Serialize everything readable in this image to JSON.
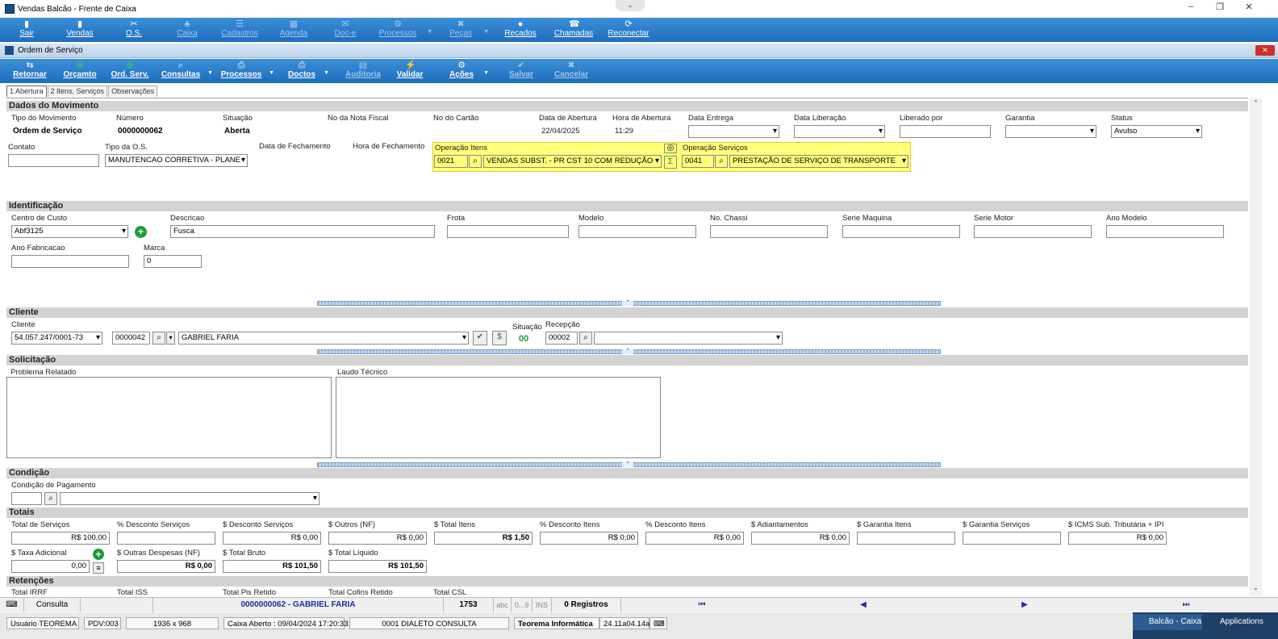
{
  "window": {
    "title": "Vendas Balcão - Frente de Caixa"
  },
  "main_toolbar": [
    {
      "label": "Sair",
      "dim": false
    },
    {
      "label": "Vendas",
      "dim": false
    },
    {
      "label": "O.S.",
      "dim": false
    },
    {
      "label": "Caixa",
      "dim": true
    },
    {
      "label": "Cadastros",
      "dim": true
    },
    {
      "label": "Agenda",
      "dim": true
    },
    {
      "label": "Doc-e",
      "dim": true
    },
    {
      "label": "Processos",
      "dim": true
    },
    {
      "label": "Peças",
      "dim": true
    },
    {
      "label": "Recados",
      "dim": false
    },
    {
      "label": "Chamadas",
      "dim": false
    },
    {
      "label": "Reconectar",
      "dim": false
    }
  ],
  "subwindow": {
    "title": "Ordem de Serviço"
  },
  "os_toolbar": [
    {
      "label": "Retornar",
      "dim": false
    },
    {
      "label": "Orçamto",
      "dim": false
    },
    {
      "label": "Ord. Serv.",
      "dim": false
    },
    {
      "label": "Consultas",
      "dim": false
    },
    {
      "label": "Processos",
      "dim": false
    },
    {
      "label": "Doctos",
      "dim": false
    },
    {
      "label": "Auditoria",
      "dim": true
    },
    {
      "label": "Validar",
      "dim": false
    },
    {
      "label": "Ações",
      "dim": false
    },
    {
      "label": "Salvar",
      "dim": true
    },
    {
      "label": "Cancelar",
      "dim": true
    }
  ],
  "tabs": [
    "1 Abertura",
    "2 Itens, Serviços",
    "Observações"
  ],
  "dados": {
    "section": "Dados do Movimento",
    "tipo_mov_label": "Tipo do Movimento",
    "tipo_mov_value": "Ordem de Serviço",
    "numero_label": "Número",
    "numero_value": "0000000062",
    "situacao_label": "Situação",
    "situacao_value": "Aberta",
    "nota_label": "No da Nota Fiscal",
    "cartao_label": "No do Cartão",
    "data_abertura_label": "Data de Abertura",
    "data_abertura_value": "22/04/2025",
    "hora_abertura_label": "Hora de Abertura",
    "hora_abertura_value": "11:29",
    "data_entrega_label": "Data Entrega",
    "data_liberacao_label": "Data Liberação",
    "liberado_label": "Liberado por",
    "garantia_label": "Garantia",
    "status_label": "Status",
    "status_value": "Avulso",
    "contato_label": "Contato",
    "tipo_os_label": "Tipo da O.S.",
    "tipo_os_value": "MANUTENCAO CORRETIVA - PLANE",
    "data_fech_label": "Data de Fechamento",
    "hora_fech_label": "Hora de Fechamento",
    "op_itens_label": "Operação Itens",
    "op_itens_code": "0021",
    "op_itens_desc": "VENDAS SUBST. - PR CST 10 COM REDUÇÃO",
    "op_serv_label": "Operação Serviços",
    "op_serv_code": "0041",
    "op_serv_desc": "PRESTAÇÃO DE SERVIÇO DE TRANSPORTE"
  },
  "identificacao": {
    "section": "Identificação",
    "centro_label": "Centro de Custo",
    "centro_value": "Abf3125",
    "descricao_label": "Descricao",
    "descricao_value": "Fusca",
    "frota_label": "Frota",
    "modelo_label": "Modelo",
    "chassi_label": "No. Chassi",
    "serie_maq_label": "Serie Maquina",
    "serie_motor_label": "Serie Motor",
    "ano_modelo_label": "Ano Modelo",
    "ano_fab_label": "Ano Fabricacao",
    "marca_label": "Marca",
    "marca_value": "0"
  },
  "cliente": {
    "section": "Cliente",
    "cliente_label": "Cliente",
    "cnpj": "54.057.247/0001-73",
    "codigo": "0000042",
    "nome": "GABRIEL FARIA",
    "situacao_label": "Situação",
    "situacao_value": "00",
    "recepcao_label": "Recepção",
    "recepcao_value": "00002"
  },
  "solicitacao": {
    "section": "Solicitação",
    "problema_label": "Problema Relatado",
    "laudo_label": "Laudo Técnico"
  },
  "condicao": {
    "section": "Condição",
    "cond_label": "Condição de Pagamento"
  },
  "totais": {
    "section": "Totais",
    "row1": [
      {
        "label": "Total de Serviços",
        "value": "R$ 100,00",
        "bold": false
      },
      {
        "label": "% Desconto Serviços",
        "value": "",
        "bold": false
      },
      {
        "label": "$ Desconto Serviços",
        "value": "R$ 0,00",
        "bold": false
      },
      {
        "label": "$ Outros (NF)",
        "value": "R$ 0,00",
        "bold": false
      },
      {
        "label": "$ Total Itens",
        "value": "R$ 1,50",
        "bold": true
      },
      {
        "label": "% Desconto Itens",
        "value": "R$ 0,00",
        "bold": false
      },
      {
        "label": "% Desconto Itens",
        "value": "R$ 0,00",
        "bold": false
      },
      {
        "label": "$ Adiantamentos",
        "value": "R$ 0,00",
        "bold": false
      },
      {
        "label": "$ Garantia Itens",
        "value": "",
        "bold": false
      },
      {
        "label": "$ Garantia Serviços",
        "value": "",
        "bold": false
      },
      {
        "label": "$ ICMS Sub. Tributária + IPI",
        "value": "R$ 0,00",
        "bold": false
      }
    ],
    "taxa_label": "$ Taxa Adicional",
    "taxa_value": "0,00",
    "outras_label": "$ Outras Despesas (NF)",
    "outras_value": "R$ 0,00",
    "bruto_label": "$ Total Bruto",
    "bruto_value": "R$ 101,50",
    "liquido_label": "$ Total Líquido",
    "liquido_value": "R$ 101,50"
  },
  "retencoes": {
    "section": "Retenções",
    "labels": [
      "Total IRRF",
      "Total ISS",
      "Total Pis Retido",
      "Total Cofins Retido",
      "Total CSL"
    ]
  },
  "statusbar": {
    "mode": "Consulta",
    "record": "0000000062 - GABRIEL FARIA",
    "num": "1753",
    "abc": "abc",
    "digits": "0...9",
    "ins": "INS",
    "registros": "0 Registros"
  },
  "bottom": {
    "usuario": "Usuário TEOREMA",
    "pdv": "PDV:003",
    "res": "1936 x 968",
    "caixa": "Caixa Aberto : 09/04/2024 17:20:33",
    "empresa": "0001 DIALETO CONSULTA",
    "vendor": "Teorema Informática",
    "version": "24.11a04.14a",
    "task1": "Balcão - Caixa",
    "task2": "Applications"
  }
}
